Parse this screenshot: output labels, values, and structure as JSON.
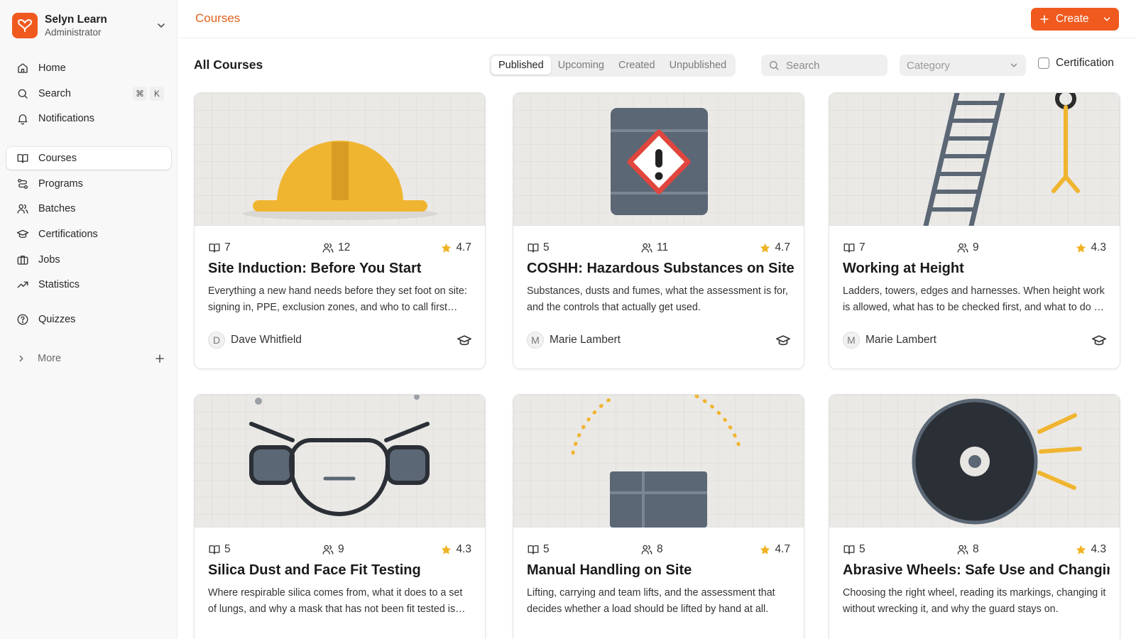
{
  "app": {
    "name": "Selyn Learn",
    "role": "Administrator",
    "logo_color": "#f05a1f"
  },
  "sidebar": {
    "top_items": [
      {
        "label": "Home",
        "icon": "home-icon"
      },
      {
        "label": "Search",
        "icon": "search-icon",
        "shortcut": [
          "⌘",
          "K"
        ]
      },
      {
        "label": "Notifications",
        "icon": "bell-icon"
      }
    ],
    "main_items": [
      {
        "label": "Courses",
        "icon": "book-open-icon",
        "active": true
      },
      {
        "label": "Programs",
        "icon": "route-icon"
      },
      {
        "label": "Batches",
        "icon": "users-icon"
      },
      {
        "label": "Certifications",
        "icon": "graduation-cap-icon"
      },
      {
        "label": "Jobs",
        "icon": "briefcase-icon"
      },
      {
        "label": "Statistics",
        "icon": "trending-up-icon"
      }
    ],
    "extra_items": [
      {
        "label": "Quizzes",
        "icon": "help-circle-icon"
      }
    ],
    "more_label": "More"
  },
  "header": {
    "breadcrumb": "Courses",
    "create_label": "Create"
  },
  "toolbar": {
    "heading": "All Courses",
    "tabs": [
      "Published",
      "Upcoming",
      "Created",
      "Unpublished"
    ],
    "active_tab": "Published",
    "search_placeholder": "Search",
    "category_placeholder": "Category",
    "certification_label": "Certification"
  },
  "courses": [
    {
      "lessons": "7",
      "students": "12",
      "rating": "4.7",
      "title": "Site Induction: Before You Start",
      "description": "Everything a new hand needs before they set foot on site: signing in, PPE, exclusion zones, and who to call first when something goes wrong.",
      "author_initial": "D",
      "author": "Dave Whitfield",
      "illustration": "hard-hat"
    },
    {
      "lessons": "5",
      "students": "11",
      "rating": "4.7",
      "title": "COSHH: Hazardous Substances on Site",
      "description": "Substances, dusts and fumes, what the assessment is for, and the controls that actually get used.",
      "author_initial": "M",
      "author": "Marie Lambert",
      "illustration": "hazard-drum"
    },
    {
      "lessons": "7",
      "students": "9",
      "rating": "4.3",
      "title": "Working at Height",
      "description": "Ladders, towers, edges and harnesses. When height work is allowed, what has to be checked first, and what to do if it is not right.",
      "author_initial": "M",
      "author": "Marie Lambert",
      "illustration": "ladder"
    },
    {
      "lessons": "5",
      "students": "9",
      "rating": "4.3",
      "title": "Silica Dust and Face Fit Testing",
      "description": "Where respirable silica comes from, what it does to a set of lungs, and why a mask that has not been fit tested is not protection.",
      "author_initial": "",
      "author": "",
      "illustration": "respirator"
    },
    {
      "lessons": "5",
      "students": "8",
      "rating": "4.7",
      "title": "Manual Handling on Site",
      "description": "Lifting, carrying and team lifts, and the assessment that decides whether a load should be lifted by hand at all.",
      "author_initial": "",
      "author": "",
      "illustration": "box"
    },
    {
      "lessons": "5",
      "students": "8",
      "rating": "4.3",
      "title": "Abrasive Wheels: Safe Use and Changing",
      "description": "Choosing the right wheel, reading its markings, changing it without wrecking it, and why the guard stays on.",
      "author_initial": "",
      "author": "",
      "illustration": "grinding-disc"
    }
  ],
  "colors": {
    "accent": "#f05a1f",
    "star": "#f0b323",
    "illustration_yellow": "#f0b530",
    "illustration_slate": "#5b6775"
  }
}
